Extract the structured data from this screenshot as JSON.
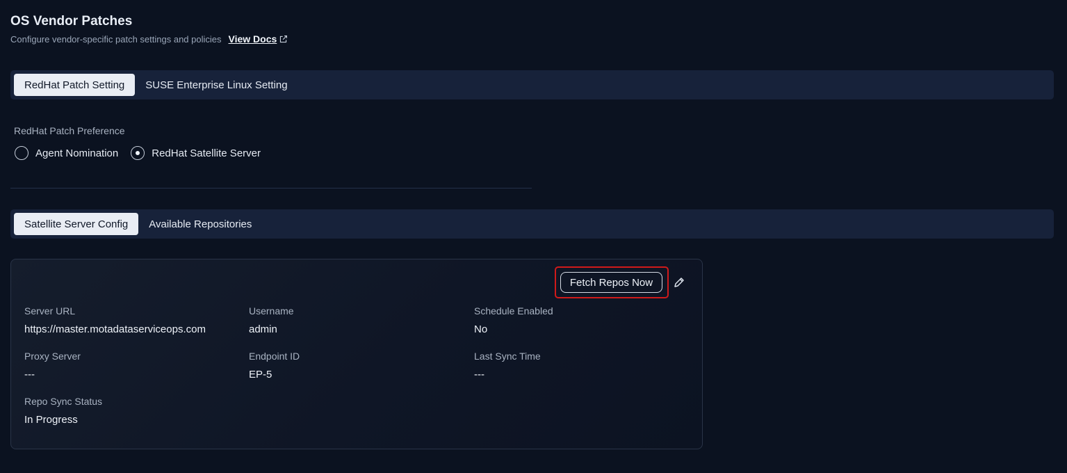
{
  "header": {
    "title": "OS Vendor Patches",
    "subtitle": "Configure vendor-specific patch settings and policies",
    "docs_link": "View Docs"
  },
  "vendor_tabs": [
    {
      "label": "RedHat Patch Setting",
      "active": true
    },
    {
      "label": "SUSE Enterprise Linux Setting",
      "active": false
    }
  ],
  "preference": {
    "label": "RedHat Patch Preference",
    "options": [
      {
        "label": "Agent Nomination",
        "selected": false
      },
      {
        "label": "RedHat Satellite Server",
        "selected": true
      }
    ]
  },
  "config_tabs": [
    {
      "label": "Satellite Server Config",
      "active": true
    },
    {
      "label": "Available Repositories",
      "active": false
    }
  ],
  "card": {
    "fetch_button": "Fetch Repos Now",
    "fields": [
      {
        "label": "Server URL",
        "value": "https://master.motadataserviceops.com"
      },
      {
        "label": "Username",
        "value": "admin"
      },
      {
        "label": "Schedule Enabled",
        "value": "No"
      },
      {
        "label": "Proxy Server",
        "value": "---"
      },
      {
        "label": "Endpoint ID",
        "value": "EP-5"
      },
      {
        "label": "Last Sync Time",
        "value": "---"
      },
      {
        "label": "Repo Sync Status",
        "value": "In Progress"
      }
    ]
  },
  "icons": {
    "docs_link_icon": "external-link-icon",
    "edit_icon": "pencil-icon"
  },
  "colors": {
    "background": "#0b1220",
    "tab_bar": "#17223a",
    "active_tab": "#e9edf4",
    "highlight": "#d01a1a"
  }
}
